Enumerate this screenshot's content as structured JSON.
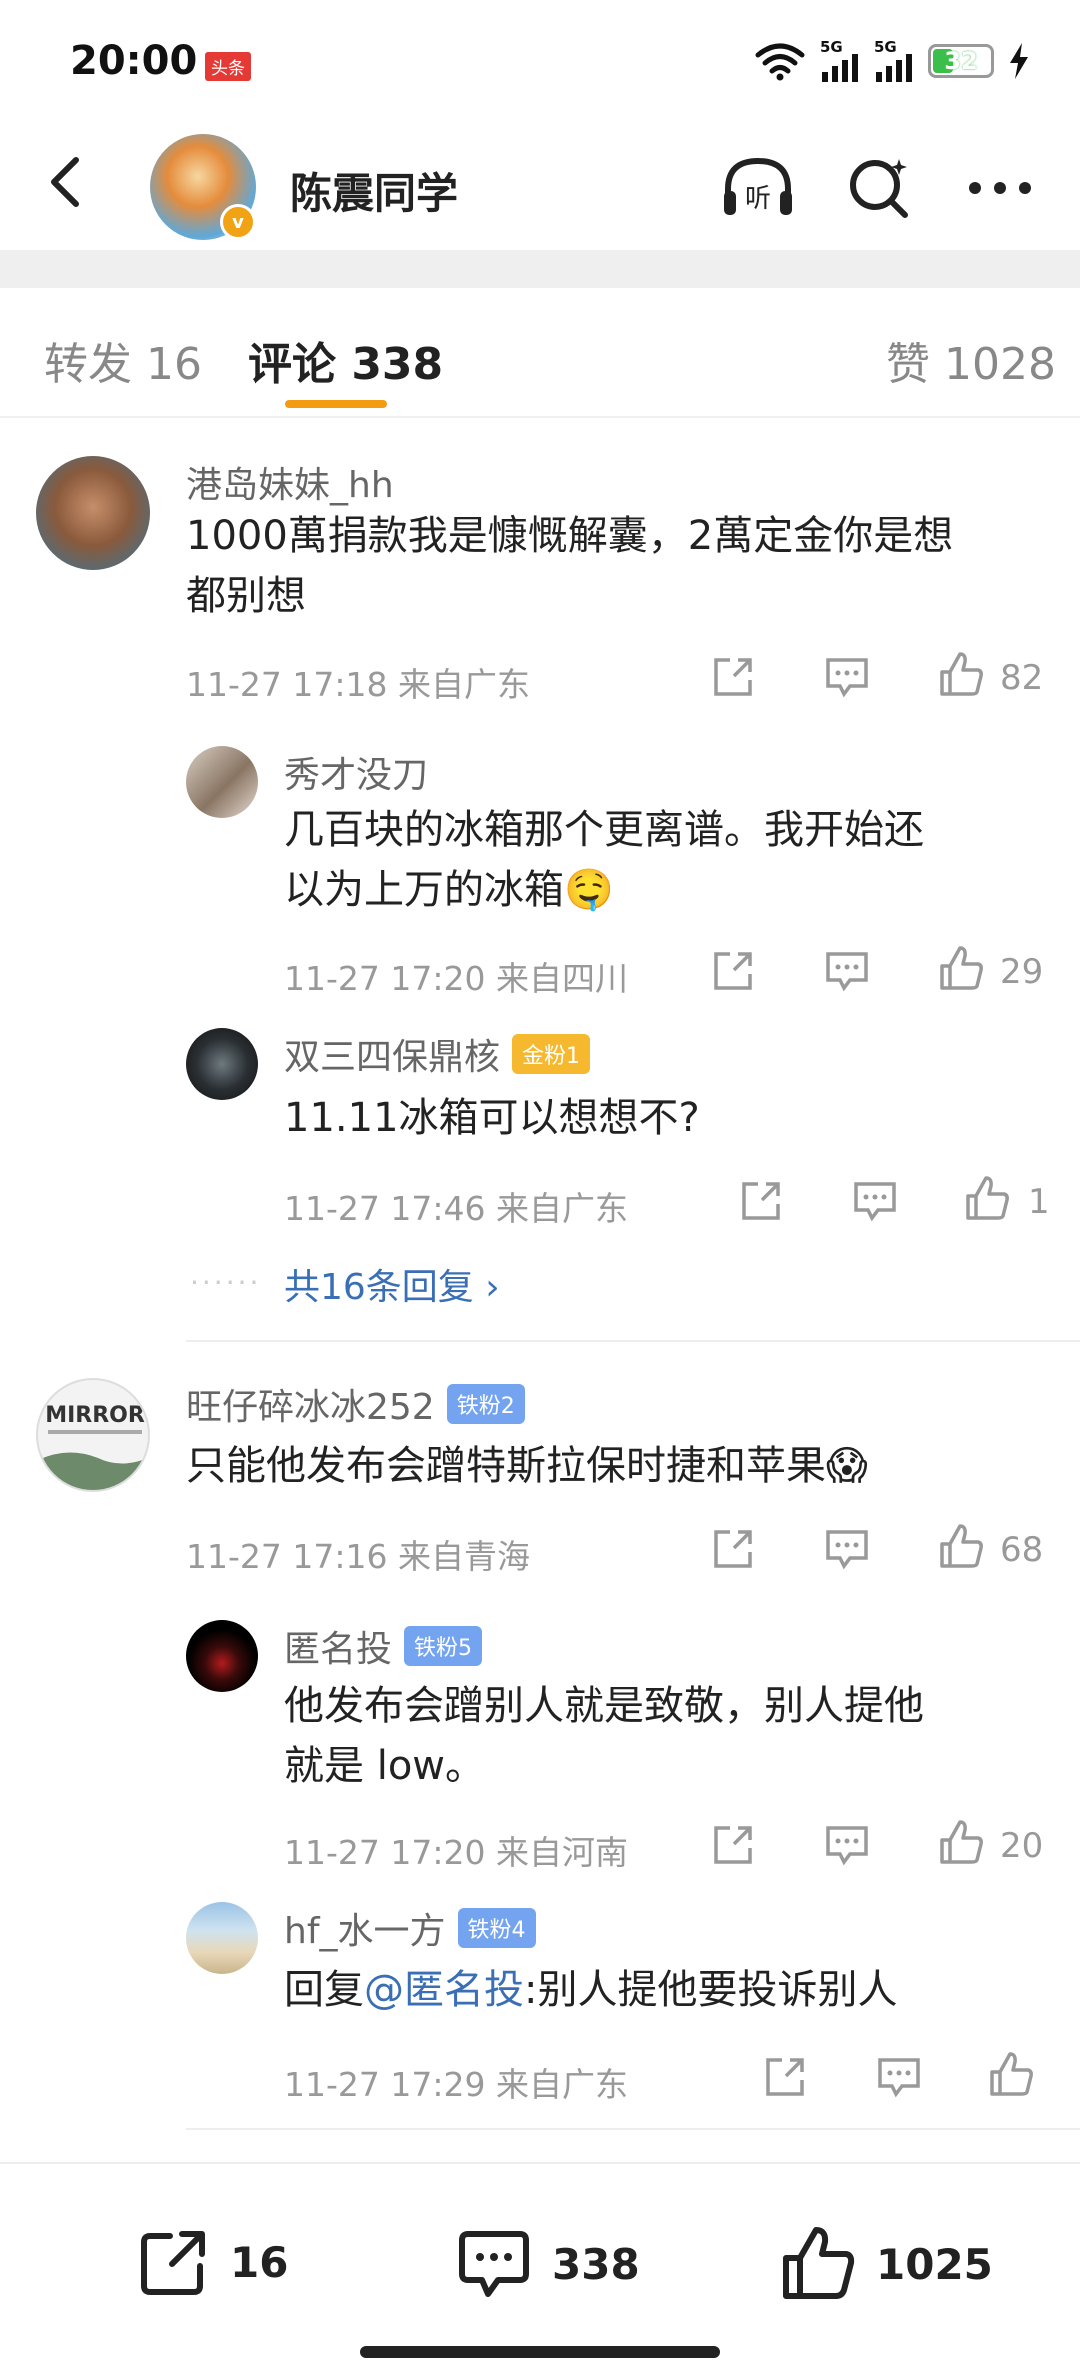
{
  "status_bar": {
    "time": "20:00",
    "news_badge": "头条",
    "net1": "5G",
    "net2": "5G",
    "battery": "32"
  },
  "header": {
    "title": "陈震同学",
    "listen_label": "听"
  },
  "tabs": {
    "repost": "转发 16",
    "comment": "评论 338",
    "like": "赞 1028"
  },
  "comments": [
    {
      "name": "港岛妹妹_hh",
      "text": "1000萬捐款我是慷慨解囊，2萬定金你是想都别想",
      "text_lines": [
        "1000萬捐款我是慷慨解囊，2萬定金你是想",
        "都别想"
      ],
      "meta": "11-27 17:18  来自广东",
      "likes": "82"
    },
    {
      "name": "旺仔碎冰冰252",
      "badge": "铁粉2",
      "text": "只能他发布会蹭特斯拉保时捷和苹果😱",
      "meta": "11-27 17:16  来自青海",
      "likes": "68"
    }
  ],
  "replies": [
    {
      "name": "秀才没刀",
      "text_lines": [
        "几百块的冰箱那个更离谱。我开始还",
        "以为上万的冰箱🤤"
      ],
      "meta": "11-27 17:20  来自四川",
      "likes": "29"
    },
    {
      "name": "双三四保鼎核",
      "badge": "金粉1",
      "text": "11.11冰箱可以想想不?",
      "meta": "11-27 17:46  来自广东",
      "likes": "1"
    },
    {
      "name": "匿名投",
      "badge": "铁粉5",
      "text_lines": [
        "他发布会蹭别人就是致敬，别人提他",
        "就是 low。"
      ],
      "meta": "11-27 17:20  来自河南",
      "likes": "20"
    },
    {
      "name": "hf_水一方",
      "badge": "铁粉4",
      "reply_prefix": "回复",
      "mention": "@匿名投",
      "text": ":别人提他要投诉别人",
      "meta": "11-27 17:29  来自广东",
      "likes": ""
    }
  ],
  "more_replies": "共16条回复 ›",
  "bottom_bar": {
    "reposts": "16",
    "comments": "338",
    "likes": "1025"
  }
}
